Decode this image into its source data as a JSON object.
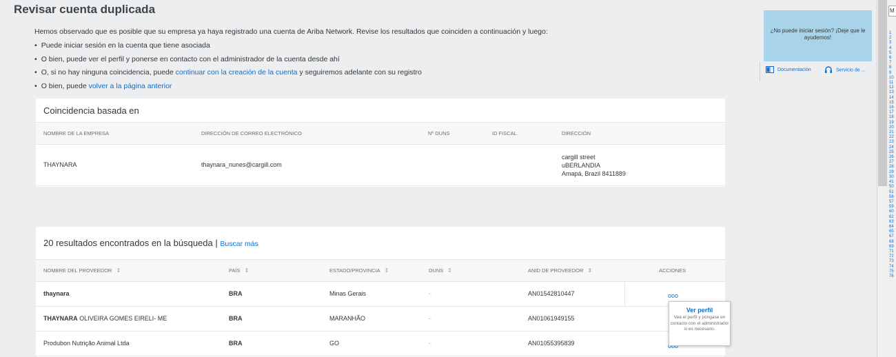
{
  "page": {
    "title": "Revisar cuenta duplicada"
  },
  "intro": {
    "lead": "Hemos observado que es posible que su empresa ya haya registrado una cuenta de Ariba Network. Revise los resultados que coinciden a continuación y luego:",
    "item1": "Puede iniciar sesión en la cuenta que tiene asociada",
    "item2": "O bien, puede ver el perfil y ponerse en contacto con el administrador de la cuenta desde ahí",
    "item3_pre": "O, si no hay ninguna coincidencia, puede ",
    "item3_link": "continuar con la creación de la cuenta",
    "item3_post": " y seguiremos adelante con su registro",
    "item4_pre": "O bien, puede ",
    "item4_link": "volver a la página anterior"
  },
  "match_card": {
    "title": "Coincidencia basada en",
    "headers": {
      "company": "NOMBRE DE LA EMPRESA",
      "email": "DIRECCIÓN DE CORREO ELECTRÓNICO",
      "duns": "Nº DUNS",
      "tax": "ID FISCAL",
      "address": "DIRECCIÓN"
    },
    "row": {
      "company": "THAYNARA",
      "email": "thaynara_nunes@cargill.com",
      "address_line1": "cargill street",
      "address_line2": "uBERLANDIA",
      "address_line3": "Amapá, Brazil 8411889"
    }
  },
  "results_card": {
    "title": "20 resultados encontrados en la búsqueda",
    "separator": "|",
    "search_more": "Buscar más",
    "headers": {
      "supplier": "NOMBRE DEL PROVEEDOR",
      "country": "PAÍS",
      "state": "ESTADO/PROVINCIA",
      "duns": "DUNS",
      "anid": "ANID DE PROVEEDOR",
      "actions": "ACCIONES"
    },
    "rows": [
      {
        "name_bold": "thaynara",
        "name_rest": "",
        "country": "BRA",
        "state": "Minas Gerais",
        "duns": "-",
        "anid": "AN01542810447"
      },
      {
        "name_bold": "THAYNARA",
        "name_rest": " OLIVEIRA GOMES EIRELI- ME",
        "country": "BRA",
        "state": "MARANHÃO",
        "duns": "-",
        "anid": "AN01061949155"
      },
      {
        "name_bold": "",
        "name_rest": "Produbon Nutrição Animal Ltda",
        "country": "BRA",
        "state": "GO",
        "duns": "-",
        "anid": "AN01055395839"
      }
    ],
    "actions_glyph": "ooo"
  },
  "popover": {
    "title": "Ver perfil",
    "description": "Vea el perfil y póngase en contacto con el administrador si es necesario."
  },
  "help": {
    "text": "¿No puede iniciar sesión? ¡Deje que le ayudemos!",
    "doc_link": "Documentación",
    "service_link": "Servicio de ..."
  },
  "right_panel": {
    "select_value": "M",
    "numbers": [
      "1",
      "2",
      "3",
      "4",
      "5",
      "6",
      "7",
      "8",
      "9",
      "10",
      "11",
      "12",
      "13",
      "14",
      "15",
      "16",
      "17",
      "18",
      "19",
      "20",
      "21",
      "22",
      "23",
      "24",
      "25",
      "26",
      "27",
      "28",
      "29",
      "30",
      "41",
      "50",
      "51",
      "56",
      "57",
      "59",
      "60",
      "62",
      "63",
      "64",
      "65",
      "67",
      "68",
      "69",
      "71",
      "72",
      "73",
      "74",
      "75",
      "76"
    ]
  },
  "colors": {
    "link": "#0a6ed1",
    "help_bg": "#a9d3e8",
    "page_bg": "#eceeef"
  }
}
